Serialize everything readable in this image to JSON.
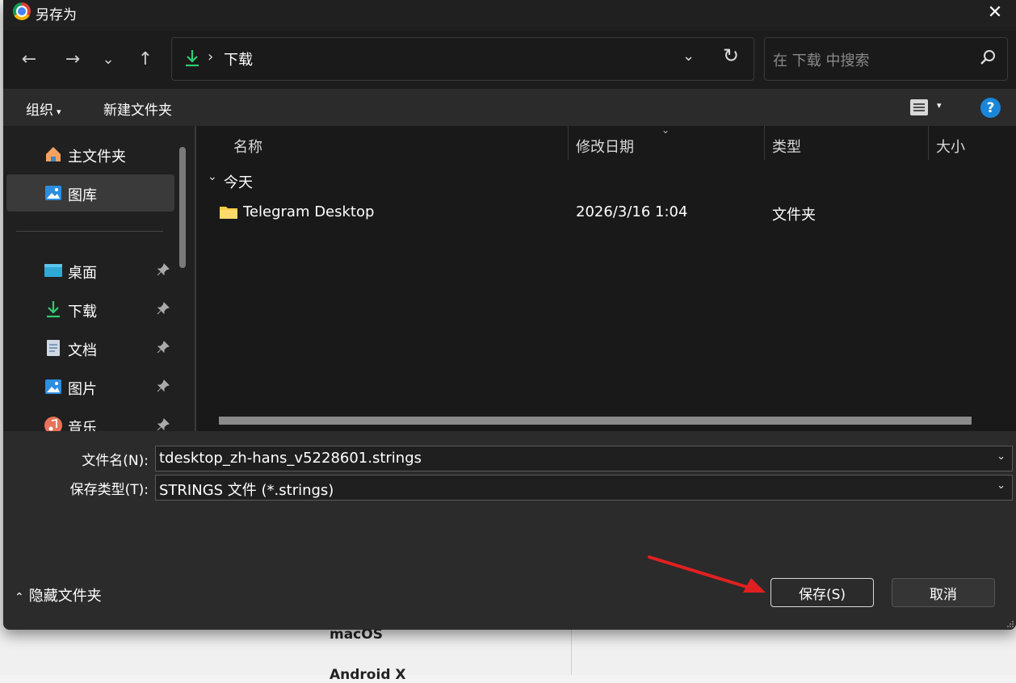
{
  "background": {
    "text_1": "macOS",
    "text_2": "Android X"
  },
  "dialog": {
    "title": "另存为",
    "close": "✕"
  },
  "nav": {
    "back": "←",
    "forward": "→",
    "recent": "⌄",
    "up": "↑",
    "address": {
      "separator": "›",
      "path": "下载",
      "dropdown": "⌄",
      "refresh": "↻"
    },
    "search": {
      "placeholder": "在 下载 中搜索"
    }
  },
  "toolbar": {
    "organize": "组织",
    "organize_caret": "▾",
    "new_folder": "新建文件夹",
    "view_caret": "▾",
    "help": "?"
  },
  "sidebar": {
    "items": [
      {
        "label": "主文件夹",
        "icon": "home-icon"
      },
      {
        "label": "图库",
        "icon": "gallery-icon",
        "selected": true
      },
      {
        "label": "桌面",
        "icon": "desktop-icon",
        "pinned": true
      },
      {
        "label": "下载",
        "icon": "download-icon",
        "pinned": true
      },
      {
        "label": "文档",
        "icon": "document-icon",
        "pinned": true
      },
      {
        "label": "图片",
        "icon": "pictures-icon",
        "pinned": true
      },
      {
        "label": "音乐",
        "icon": "music-icon",
        "pinned": true
      }
    ]
  },
  "filelist": {
    "columns": [
      "名称",
      "修改日期",
      "类型",
      "大小"
    ],
    "sort_caret": "⌄",
    "group": {
      "label": "今天",
      "caret": "⌄"
    },
    "rows": [
      {
        "name": "Telegram Desktop",
        "date": "2026/3/16 1:04",
        "type": "文件夹",
        "icon": "folder-icon"
      }
    ]
  },
  "form": {
    "filename_label": "文件名(N):",
    "filename_value": "tdesktop_zh-hans_v5228601.strings",
    "filetype_label": "保存类型(T):",
    "filetype_value": "STRINGS 文件 (*.strings)",
    "caret": "⌄"
  },
  "footer": {
    "hide_folders": "隐藏文件夹",
    "hide_caret": "⌃",
    "save": "保存(S)",
    "cancel": "取消"
  },
  "colors": {
    "accent": "#1a86d9",
    "download_green": "#2ecc71",
    "folder_yellow": "#f7c948",
    "annotation_red": "#e02020"
  }
}
